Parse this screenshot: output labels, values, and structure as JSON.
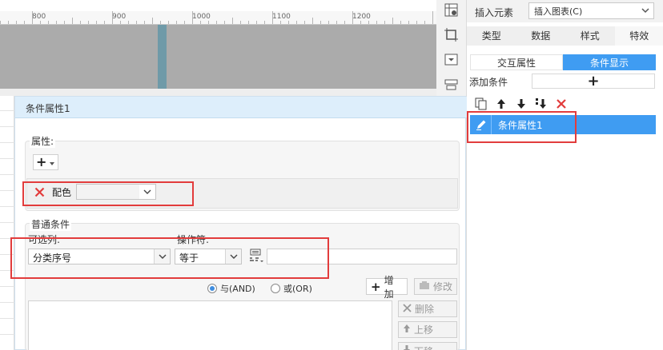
{
  "ruler": {
    "ticks": [
      "800",
      "900",
      "1000",
      "1100",
      "1200"
    ]
  },
  "right_panel": {
    "insert_element_label": "插入元素",
    "insert_select_value": "插入图表(C)",
    "tabs": [
      "类型",
      "数据",
      "样式",
      "特效"
    ],
    "active_tab": "特效",
    "subtabs": [
      "交互属性",
      "条件显示"
    ],
    "active_subtab": "条件显示",
    "add_condition_label": "添加条件",
    "add_condition_symbol": "+",
    "condition_items": [
      "条件属性1"
    ]
  },
  "dialog": {
    "title": "条件属性1",
    "property_legend": "属性:",
    "property_add_symbol": "+",
    "property_name": "配色",
    "common_legend": "普通条件",
    "column_label": "可选列:",
    "column_value": "分类序号",
    "operator_label": "操作符:",
    "operator_value": "等于",
    "value_input": "",
    "radio_and": "与(AND)",
    "radio_or": "或(OR)",
    "add_button": "增加",
    "modify_button": "修改",
    "delete_button": "删除",
    "move_up_button": "上移",
    "move_down_button": "下移"
  },
  "colors": {
    "accent": "#3f9cf2",
    "highlight": "#e23c3c",
    "dialog_header": "#ddeefb"
  },
  "icons": [
    "dataset-icon",
    "frame-icon",
    "dropdown-widget-icon",
    "layout-icon",
    "copy-icon",
    "arrow-up-icon",
    "arrow-down-icon",
    "move-bottom-icon",
    "delete-icon",
    "edit-icon",
    "formula-icon"
  ]
}
